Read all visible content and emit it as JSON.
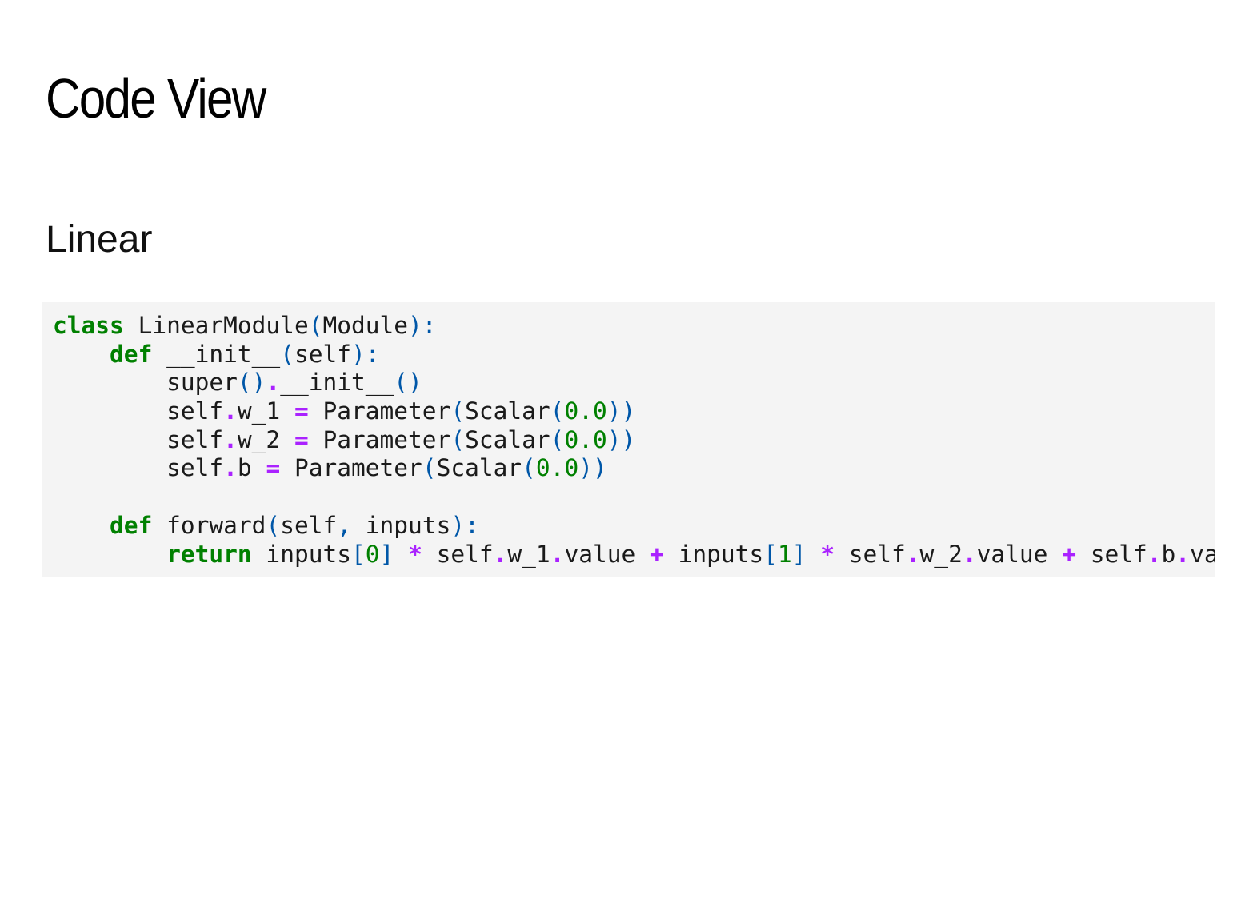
{
  "page": {
    "title": "Code View"
  },
  "section": {
    "title": "Linear"
  },
  "code": {
    "language": "python",
    "colors": {
      "keyword": "#008000",
      "operator": "#aa22ff",
      "punctuation": "#0057a8",
      "number": "#008000",
      "text": "#1a1a1a",
      "background": "#f4f4f4"
    },
    "lines": [
      [
        {
          "t": "kw",
          "v": "class"
        },
        {
          "t": "plain",
          "v": " LinearModule"
        },
        {
          "t": "punc",
          "v": "("
        },
        {
          "t": "plain",
          "v": "Module"
        },
        {
          "t": "punc",
          "v": "):"
        }
      ],
      [
        {
          "t": "plain",
          "v": "    "
        },
        {
          "t": "kw",
          "v": "def"
        },
        {
          "t": "plain",
          "v": " __init__"
        },
        {
          "t": "punc",
          "v": "("
        },
        {
          "t": "plain",
          "v": "self"
        },
        {
          "t": "punc",
          "v": "):"
        }
      ],
      [
        {
          "t": "plain",
          "v": "        super"
        },
        {
          "t": "punc",
          "v": "()"
        },
        {
          "t": "op",
          "v": "."
        },
        {
          "t": "plain",
          "v": "__init__"
        },
        {
          "t": "punc",
          "v": "()"
        }
      ],
      [
        {
          "t": "plain",
          "v": "        self"
        },
        {
          "t": "op",
          "v": "."
        },
        {
          "t": "plain",
          "v": "w_1 "
        },
        {
          "t": "op",
          "v": "="
        },
        {
          "t": "plain",
          "v": " Parameter"
        },
        {
          "t": "punc",
          "v": "("
        },
        {
          "t": "plain",
          "v": "Scalar"
        },
        {
          "t": "punc",
          "v": "("
        },
        {
          "t": "num",
          "v": "0.0"
        },
        {
          "t": "punc",
          "v": "))"
        }
      ],
      [
        {
          "t": "plain",
          "v": "        self"
        },
        {
          "t": "op",
          "v": "."
        },
        {
          "t": "plain",
          "v": "w_2 "
        },
        {
          "t": "op",
          "v": "="
        },
        {
          "t": "plain",
          "v": " Parameter"
        },
        {
          "t": "punc",
          "v": "("
        },
        {
          "t": "plain",
          "v": "Scalar"
        },
        {
          "t": "punc",
          "v": "("
        },
        {
          "t": "num",
          "v": "0.0"
        },
        {
          "t": "punc",
          "v": "))"
        }
      ],
      [
        {
          "t": "plain",
          "v": "        self"
        },
        {
          "t": "op",
          "v": "."
        },
        {
          "t": "plain",
          "v": "b "
        },
        {
          "t": "op",
          "v": "="
        },
        {
          "t": "plain",
          "v": " Parameter"
        },
        {
          "t": "punc",
          "v": "("
        },
        {
          "t": "plain",
          "v": "Scalar"
        },
        {
          "t": "punc",
          "v": "("
        },
        {
          "t": "num",
          "v": "0.0"
        },
        {
          "t": "punc",
          "v": "))"
        }
      ],
      [],
      [
        {
          "t": "plain",
          "v": "    "
        },
        {
          "t": "kw",
          "v": "def"
        },
        {
          "t": "plain",
          "v": " forward"
        },
        {
          "t": "punc",
          "v": "("
        },
        {
          "t": "plain",
          "v": "self"
        },
        {
          "t": "punc",
          "v": ","
        },
        {
          "t": "plain",
          "v": " inputs"
        },
        {
          "t": "punc",
          "v": "):"
        }
      ],
      [
        {
          "t": "plain",
          "v": "        "
        },
        {
          "t": "kw",
          "v": "return"
        },
        {
          "t": "plain",
          "v": " inputs"
        },
        {
          "t": "punc",
          "v": "["
        },
        {
          "t": "num",
          "v": "0"
        },
        {
          "t": "punc",
          "v": "]"
        },
        {
          "t": "plain",
          "v": " "
        },
        {
          "t": "op",
          "v": "*"
        },
        {
          "t": "plain",
          "v": " self"
        },
        {
          "t": "op",
          "v": "."
        },
        {
          "t": "plain",
          "v": "w_1"
        },
        {
          "t": "op",
          "v": "."
        },
        {
          "t": "plain",
          "v": "value "
        },
        {
          "t": "op",
          "v": "+"
        },
        {
          "t": "plain",
          "v": " inputs"
        },
        {
          "t": "punc",
          "v": "["
        },
        {
          "t": "num",
          "v": "1"
        },
        {
          "t": "punc",
          "v": "]"
        },
        {
          "t": "plain",
          "v": " "
        },
        {
          "t": "op",
          "v": "*"
        },
        {
          "t": "plain",
          "v": " self"
        },
        {
          "t": "op",
          "v": "."
        },
        {
          "t": "plain",
          "v": "w_2"
        },
        {
          "t": "op",
          "v": "."
        },
        {
          "t": "plain",
          "v": "value "
        },
        {
          "t": "op",
          "v": "+"
        },
        {
          "t": "plain",
          "v": " self"
        },
        {
          "t": "op",
          "v": "."
        },
        {
          "t": "plain",
          "v": "b"
        },
        {
          "t": "op",
          "v": "."
        },
        {
          "t": "plain",
          "v": "va"
        }
      ]
    ]
  }
}
